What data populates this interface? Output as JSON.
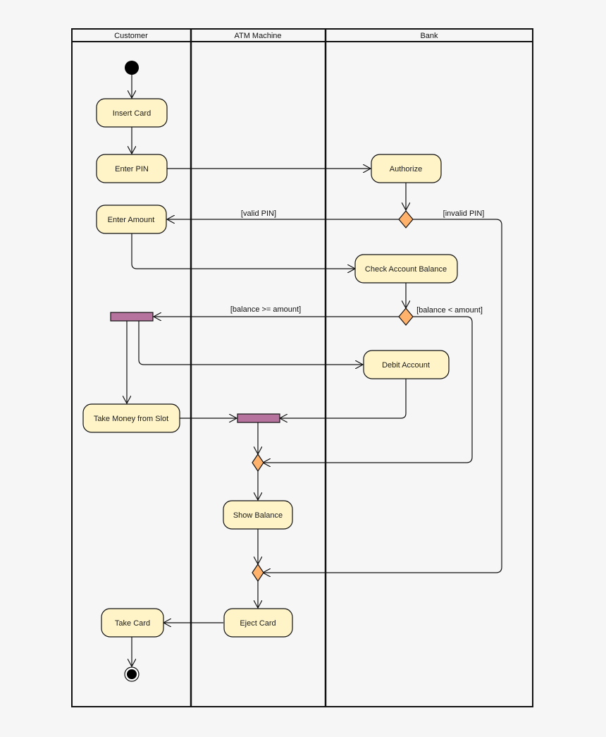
{
  "diagram": {
    "type": "UML activity diagram",
    "colors": {
      "background": "#f6f6f6",
      "action_fill": "#fff4c8",
      "decision_fill": "#ffb26b",
      "bar_fill": "#b5739d",
      "stroke": "#111111"
    },
    "lanes": [
      {
        "id": "customer",
        "label": "Customer"
      },
      {
        "id": "atm",
        "label": "ATM Machine"
      },
      {
        "id": "bank",
        "label": "Bank"
      }
    ],
    "actions": {
      "insert_card": "Insert Card",
      "enter_pin": "Enter PIN",
      "authorize": "Authorize",
      "enter_amount": "Enter Amount",
      "check_balance": "Check Account Balance",
      "debit_account": "Debit Account",
      "take_money": "Take Money from Slot",
      "show_balance": "Show Balance",
      "eject_card": "Eject Card",
      "take_card": "Take Card"
    },
    "guards": {
      "valid_pin": "[valid PIN]",
      "invalid_pin": "[invalid PIN]",
      "balance_ok": "[balance >= amount]",
      "balance_low": "[balance < amount]"
    }
  }
}
